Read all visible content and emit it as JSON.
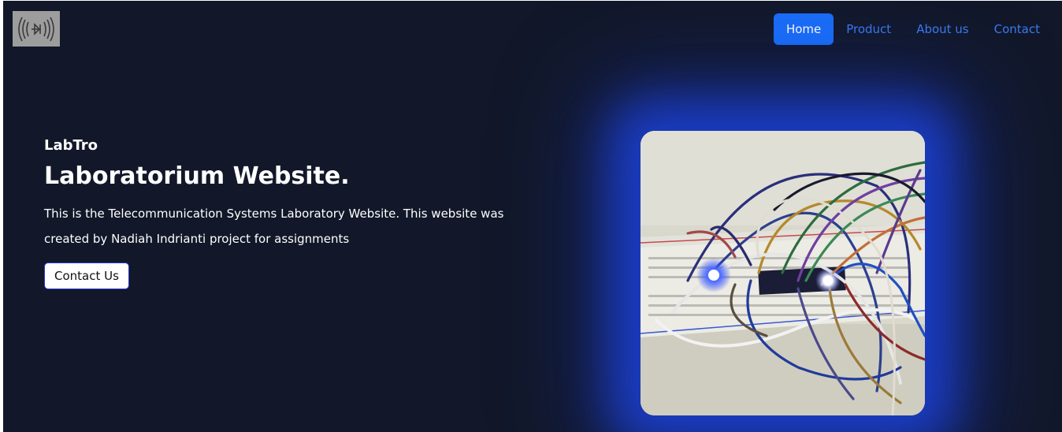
{
  "nav": {
    "logo_icon": "oscillator-signal-logo",
    "items": [
      {
        "label": "Home",
        "active": true
      },
      {
        "label": "Product",
        "active": false
      },
      {
        "label": "About us",
        "active": false
      },
      {
        "label": "Contact",
        "active": false
      }
    ],
    "active_color": "#1a6ef7",
    "link_color": "#3b7bf0"
  },
  "hero": {
    "brand": "LabTro",
    "headline": "Laboratorium Website.",
    "description": "This is the Telecommunication Systems Laboratory Website. This website was created by Nadiah Indrianti project for assignments",
    "cta_label": "Contact Us",
    "image": "breadboard-circuit-photo"
  },
  "colors": {
    "background": "#121829",
    "glow": "#1e46e6"
  }
}
